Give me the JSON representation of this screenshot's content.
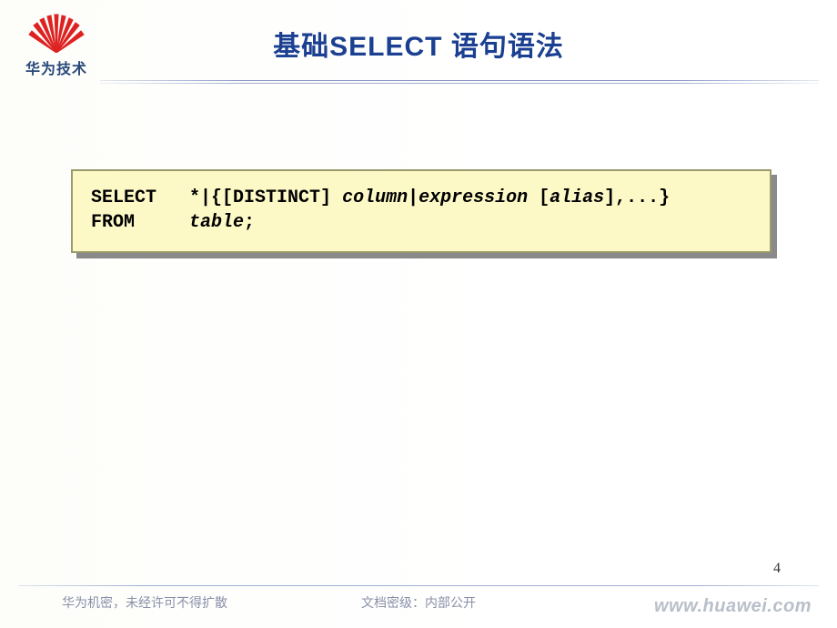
{
  "header": {
    "logo_text": "华为技术",
    "title": "基础SELECT 语句语法"
  },
  "code": {
    "line1_keyword": "SELECT",
    "line1_pad": "   ",
    "line1_text_a": "*|{[DISTINCT] ",
    "line1_italic_a": "column",
    "line1_text_b": "|",
    "line1_italic_b": "expression",
    "line1_text_c": " [",
    "line1_italic_c": "alias",
    "line1_text_d": "],...}",
    "line2_keyword": "FROM",
    "line2_pad": "     ",
    "line2_italic": "table",
    "line2_text": ";"
  },
  "page_number": "4",
  "footer": {
    "left": "华为机密，未经许可不得扩散",
    "center": "文档密级：内部公开",
    "right": "www.huawei.com"
  }
}
